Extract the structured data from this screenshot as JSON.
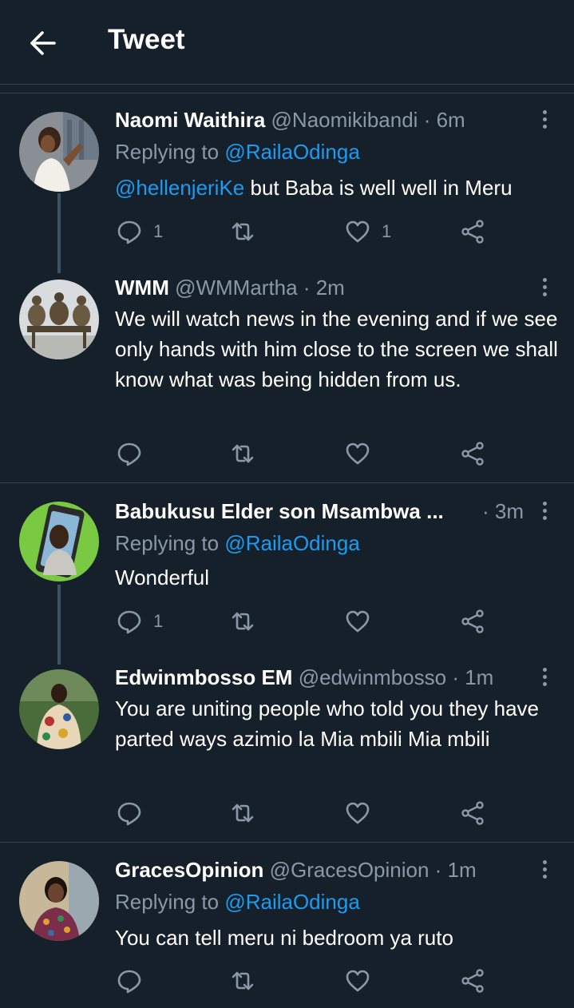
{
  "header": {
    "title": "Tweet"
  },
  "tweets": [
    {
      "name": "Naomi Waithira",
      "handle": "@Naomikibandi",
      "time": "· 6m",
      "replying_prefix": "Replying to",
      "replying_to": "@RailaOdinga",
      "mention": "@hellenjeriKe",
      "text": " but Baba is well well in Meru",
      "reply_count": "1",
      "retweet_count": "",
      "like_count": "1"
    },
    {
      "name": "WMM",
      "handle": "@WMMartha",
      "time": "· 2m",
      "text": "We will watch news in the evening and if we see only hands with him close to the screen we shall know what was being hidden from us.",
      "reply_count": "",
      "retweet_count": "",
      "like_count": ""
    },
    {
      "name": "Babukusu Elder son Msambwa ...",
      "handle": "",
      "time": "· 3m",
      "replying_prefix": "Replying to",
      "replying_to": "@RailaOdinga",
      "text": "Wonderful",
      "reply_count": "1",
      "retweet_count": "",
      "like_count": ""
    },
    {
      "name": "Edwinmbosso EM",
      "handle": "@edwinmbosso",
      "time": "· 1m",
      "text": "You are uniting people who told you they have parted ways azimio la Mia mbili Mia mbili",
      "reply_count": "",
      "retweet_count": "",
      "like_count": ""
    },
    {
      "name": "GracesOpinion",
      "handle": "@GracesOpinion",
      "time": "· 1m",
      "replying_prefix": "Replying to",
      "replying_to": "@RailaOdinga",
      "text": "You can tell meru ni bedroom ya ruto",
      "reply_count": "",
      "retweet_count": "",
      "like_count": ""
    }
  ],
  "colors": {
    "background": "#15202b",
    "secondary_text": "#8b98a5",
    "link": "#1d9bf0",
    "divider": "#38444d"
  },
  "icons": [
    "back-arrow-icon",
    "more-icon",
    "reply-icon",
    "retweet-icon",
    "like-icon",
    "share-icon"
  ]
}
